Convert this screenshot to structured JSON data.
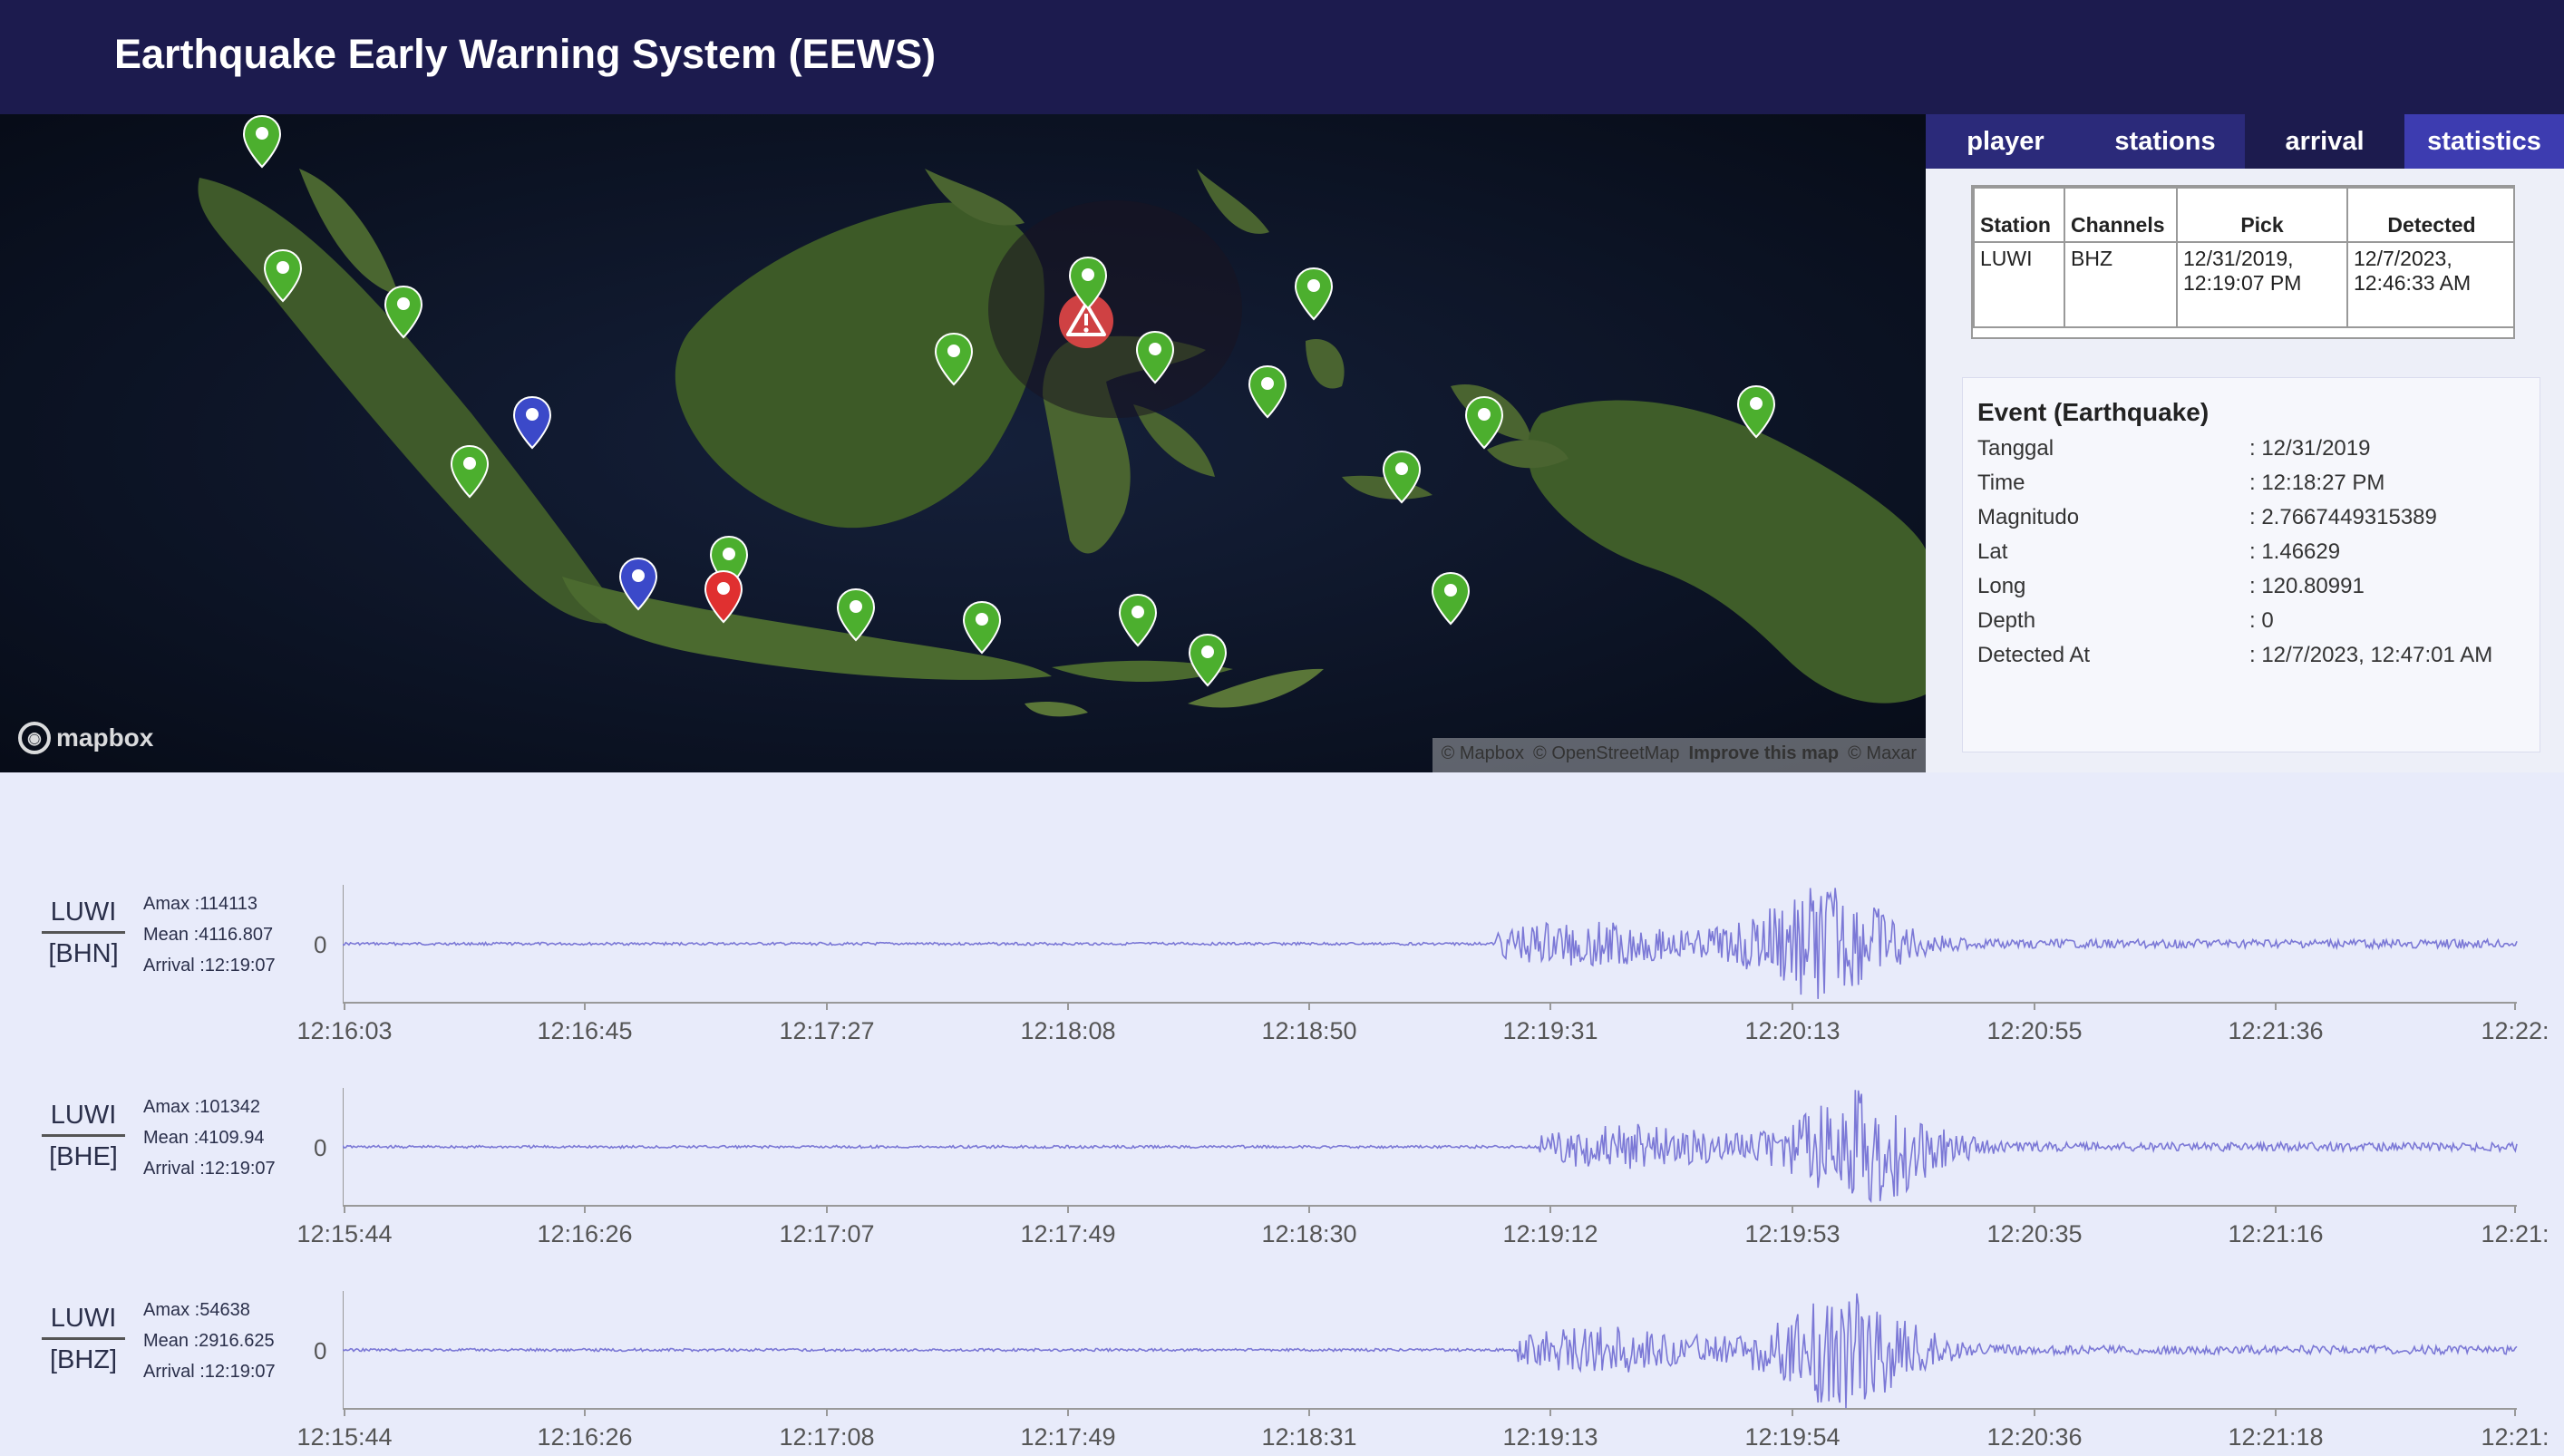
{
  "header": {
    "title": "Earthquake Early Warning System (EEWS)"
  },
  "map": {
    "logo": "mapbox",
    "attribution": {
      "mapbox": "© Mapbox",
      "osm": "© OpenStreetMap",
      "improve": "Improve this map",
      "maxar": "© Maxar"
    },
    "colors": {
      "station_ok": "#4caf2e",
      "station_blue": "#3b49c9",
      "station_red": "#e03030",
      "alert": "#e04545"
    }
  },
  "panel": {
    "tabs": [
      {
        "label": "player"
      },
      {
        "label": "stations"
      },
      {
        "label": "arrival"
      },
      {
        "label": "statistics"
      }
    ],
    "pick_table": {
      "headers": [
        "Station",
        "Channels",
        "Pick",
        "Detected"
      ],
      "row": [
        "LUWI",
        "BHZ",
        "12/31/2019, 12:19:07 PM",
        "12/7/2023, 12:46:33 AM"
      ]
    },
    "event": {
      "title": "Event (Earthquake)",
      "rows": [
        {
          "label": "Tanggal",
          "value": ": 12/31/2019"
        },
        {
          "label": "Time",
          "value": ": 12:18:27 PM"
        },
        {
          "label": "Magnitudo",
          "value": ": 2.7667449315389"
        },
        {
          "label": "Lat",
          "value": ": 1.46629"
        },
        {
          "label": "Long",
          "value": ": 120.80991"
        },
        {
          "label": "Depth",
          "value": ": 0"
        },
        {
          "label": "Detected At",
          "value": ": 12/7/2023, 12:47:01 AM"
        }
      ]
    }
  },
  "waves": [
    {
      "station": "LUWI",
      "channel": "[BHN]",
      "amax": "Amax :114113",
      "mean": "Mean :4116.807",
      "arrival": "Arrival :12:19:07",
      "zero": "0",
      "ticks": [
        "12:16:03",
        "12:16:45",
        "12:17:27",
        "12:18:08",
        "12:18:50",
        "12:19:31",
        "12:20:13",
        "12:20:55",
        "12:21:36",
        "12:22:"
      ]
    },
    {
      "station": "LUWI",
      "channel": "[BHE]",
      "amax": "Amax :101342",
      "mean": "Mean :4109.94",
      "arrival": "Arrival :12:19:07",
      "zero": "0",
      "ticks": [
        "12:15:44",
        "12:16:26",
        "12:17:07",
        "12:17:49",
        "12:18:30",
        "12:19:12",
        "12:19:53",
        "12:20:35",
        "12:21:16",
        "12:21:"
      ]
    },
    {
      "station": "LUWI",
      "channel": "[BHZ]",
      "amax": "Amax :54638",
      "mean": "Mean :2916.625",
      "arrival": "Arrival :12:19:07",
      "zero": "0",
      "ticks": [
        "12:15:44",
        "12:16:26",
        "12:17:08",
        "12:17:49",
        "12:18:31",
        "12:19:13",
        "12:19:54",
        "12:20:36",
        "12:21:18",
        "12:21:"
      ]
    }
  ],
  "wave_color": "#7b78d6"
}
